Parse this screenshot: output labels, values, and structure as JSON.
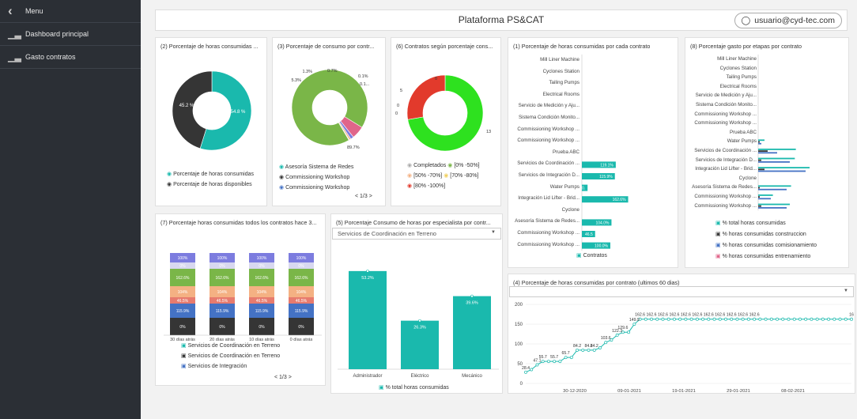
{
  "sidebar": {
    "menu_label": "Menu",
    "items": [
      {
        "label": "Dashboard principal"
      },
      {
        "label": "Gasto contratos"
      }
    ]
  },
  "header": {
    "title": "Plataforma PS&CAT",
    "user": "usuario@cyd-tec.com"
  },
  "colors": {
    "teal": "#1ab9ad",
    "dark": "#353535",
    "green": "#7ab648",
    "red": "#e23a2c",
    "bright_green": "#2ee11f",
    "pink": "#e0658a",
    "blue": "#4472c4",
    "orange": "#f4b183",
    "purple": "#7c7cdf",
    "salmon": "#e77b6e"
  },
  "p2": {
    "title": "(2) Porcentaje de horas consumidas ...",
    "legend": [
      "Porcentaje de horas consumidas",
      "Porcentaje de horas disponibles"
    ],
    "chart_data": {
      "type": "pie",
      "labels": [
        "Porcentaje de horas consumidas",
        "Porcentaje de horas disponibles"
      ],
      "values": [
        54.8,
        45.2
      ],
      "data_labels": [
        "54.8 %",
        "45.2 %"
      ]
    }
  },
  "p3": {
    "title": "(3) Porcentaje de consumo por contr...",
    "legend": [
      "Asesoría Sistema de Redes",
      "Commissioning Workshop",
      "Commissioning Workshop"
    ],
    "pager": "< 1/3 >",
    "chart_data": {
      "type": "pie",
      "values": [
        89.7,
        5.3,
        1.3,
        0.7,
        0.1,
        0.1
      ],
      "data_labels": [
        "89.7%",
        "5.3%",
        "1.3%",
        "0.7%",
        "0.1%",
        "0.1..."
      ]
    }
  },
  "p6": {
    "title": "(6) Contratos según porcentaje cons...",
    "legend": [
      "Completados",
      "[0% -50%]",
      "[50% -70%]",
      "[70% -80%]",
      "[80% -100%]"
    ],
    "chart_data": {
      "type": "pie",
      "labels": [
        "Completados",
        "[80% -100%]",
        "[0% -50%]",
        "[50% -70%]"
      ],
      "values": [
        13,
        5,
        0,
        0
      ],
      "data_labels": [
        "13",
        "5",
        "0",
        "0",
        "0"
      ]
    }
  },
  "p1": {
    "title": "(1) Porcentaje de horas consumidas por cada contrato",
    "legend": "Contratos",
    "chart_data": {
      "type": "bar",
      "categories": [
        "Mill Liner Machine",
        "Cyclones Station",
        "Tailing Pumps",
        "Electrical Rooms",
        "Servicio de Medición y Aju...",
        "Sistema Condición Monito...",
        "Commissioning Workshop ...",
        "Commissioning Workshop ...",
        "Prueba ABC",
        "Servicios de Coordinación ...",
        "Servicios de Integración D...",
        "Water Pumps",
        "Integración Lid Lifter - Brid...",
        "Cyclone",
        "Asesoría Sistema de Redes...",
        "Commissioning Workshop ...",
        "Commissioning Workshop ..."
      ],
      "values": [
        0,
        0,
        0,
        0,
        0,
        0,
        0,
        0,
        0,
        119.1,
        115.9,
        20,
        162.6,
        0,
        104,
        46.5,
        100
      ],
      "data_labels": [
        "",
        "",
        "",
        "",
        "",
        "",
        "",
        "",
        "",
        "119.1%",
        "115.9%",
        "20.",
        "162.6%",
        "",
        "104.0%",
        "46.5",
        "100.0%"
      ]
    }
  },
  "p8": {
    "title": "(8) Porcentaje gasto por etapas por contrato",
    "legend": [
      "% total horas consumidas",
      "% horas consumidas construccion",
      "% horas consumidas comisionamiento",
      "% horas consumidas entrenamiento"
    ],
    "chart_data": {
      "type": "bar",
      "categories": [
        "Mill Liner Machine",
        "Cyclones Station",
        "Tailing Pumps",
        "Electrical Rooms",
        "Servicio de Medición y Aju...",
        "Sistema Condición Monito...",
        "Commissioning Workshop ...",
        "Commissioning Workshop ...",
        "Prueba ABC",
        "Water Pumps",
        "Servicios de Coordinación ...",
        "Servicios de Integración D...",
        "Integración Lid Lifter - Brid...",
        "Cyclone",
        "Asesoría Sistema de Redes...",
        "Commissioning Workshop ...",
        "Commissioning Workshop ..."
      ],
      "series": [
        {
          "name": "% total horas consumidas",
          "values": [
            0,
            0,
            0,
            0,
            0,
            0,
            0,
            0,
            0,
            20,
            119.1,
            115.9,
            162.6,
            0,
            104,
            46.5,
            100
          ]
        },
        {
          "name": "% horas consumidas construccion",
          "values": [
            0,
            0,
            0,
            0,
            0,
            0,
            0,
            0,
            0,
            5,
            30,
            10,
            20,
            0,
            5,
            5,
            10
          ]
        },
        {
          "name": "% horas consumidas comisionamiento",
          "values": [
            0,
            0,
            0,
            0,
            0,
            0,
            0,
            0,
            0,
            10,
            60,
            100,
            150,
            0,
            90,
            40,
            90
          ]
        },
        {
          "name": "% horas consumidas entrenamiento",
          "values": [
            0,
            0,
            0,
            0,
            0,
            0,
            0,
            0,
            0,
            0,
            0,
            0,
            0,
            0,
            0,
            0,
            0
          ]
        }
      ]
    }
  },
  "p7": {
    "title": "(7) Porcentaje horas consumidas todos los contratos hace 3...",
    "legend": [
      "Servicios de Coordinación en Terreno",
      "Servicios de Coordinación en Terreno",
      "Servicios de Integración"
    ],
    "pager": "< 1/3 >",
    "chart_data": {
      "type": "bar",
      "categories": [
        "30 días atrás",
        "20 días atrás",
        "10 días atrás",
        "0 días atrás"
      ],
      "segment_labels": [
        "0%",
        "115.9%",
        "46.5%",
        "104%",
        "162.6%",
        "0%",
        "100%"
      ]
    }
  },
  "p5": {
    "title": "(5) Porcentaje Consumo de horas por especialista por contr...",
    "dropdown": "Servicios de Coordinación en Terreno",
    "legend": "% total horas consumidas",
    "chart_data": {
      "type": "bar",
      "categories": [
        "Administrador",
        "Eléctrico",
        "Mecánico"
      ],
      "values": [
        53.2,
        26.3,
        39.6
      ],
      "data_labels": [
        "53.2%",
        "26.3%",
        "39.6%"
      ],
      "ylim": [
        0,
        60
      ]
    }
  },
  "p4": {
    "title": "(4) Porcentaje de horas consumidas por contrato (ultimos 60 dias)",
    "chart_data": {
      "type": "line",
      "x_ticks": [
        "30-12-2020",
        "09-01-2021",
        "19-01-2021",
        "29-01-2021",
        "08-02-2021"
      ],
      "yticks": [
        "0",
        "50",
        "100",
        "150",
        "200"
      ],
      "ylim": [
        0,
        200
      ],
      "values": [
        28.4,
        35,
        47.1,
        55.7,
        55.7,
        55.7,
        55.7,
        65.7,
        65.7,
        84.2,
        84.2,
        84.2,
        84.2,
        90,
        103.6,
        110,
        122.3,
        129.6,
        129.6,
        149.9,
        162.6,
        162.6,
        162.6,
        162.6,
        162.6,
        162.6,
        162.6,
        162.6,
        162.6,
        162.6,
        162.6,
        162.6,
        162.6,
        162.6,
        162.6,
        162.6,
        162.6,
        162.6,
        162.6,
        162.6,
        162.6,
        162.6,
        162.6,
        162.6,
        162.6,
        162.6,
        162.6,
        162.6,
        162.6,
        162.6,
        162.6,
        162.6,
        162.6,
        162.6,
        162.6,
        162.6,
        162.6,
        162.6
      ],
      "data_labels": [
        "28.4",
        "47.1",
        "55.7",
        "55.7",
        "65.7",
        "84.2",
        "84.2",
        "84.2",
        "103.6",
        "122.3",
        "129.6",
        "149.9",
        "162.6",
        "162.6",
        "162.6",
        "162.6",
        "162.6",
        "162.6",
        "162.6",
        "162.6",
        "162.6",
        "162.6",
        "162.6",
        "16"
      ]
    }
  }
}
